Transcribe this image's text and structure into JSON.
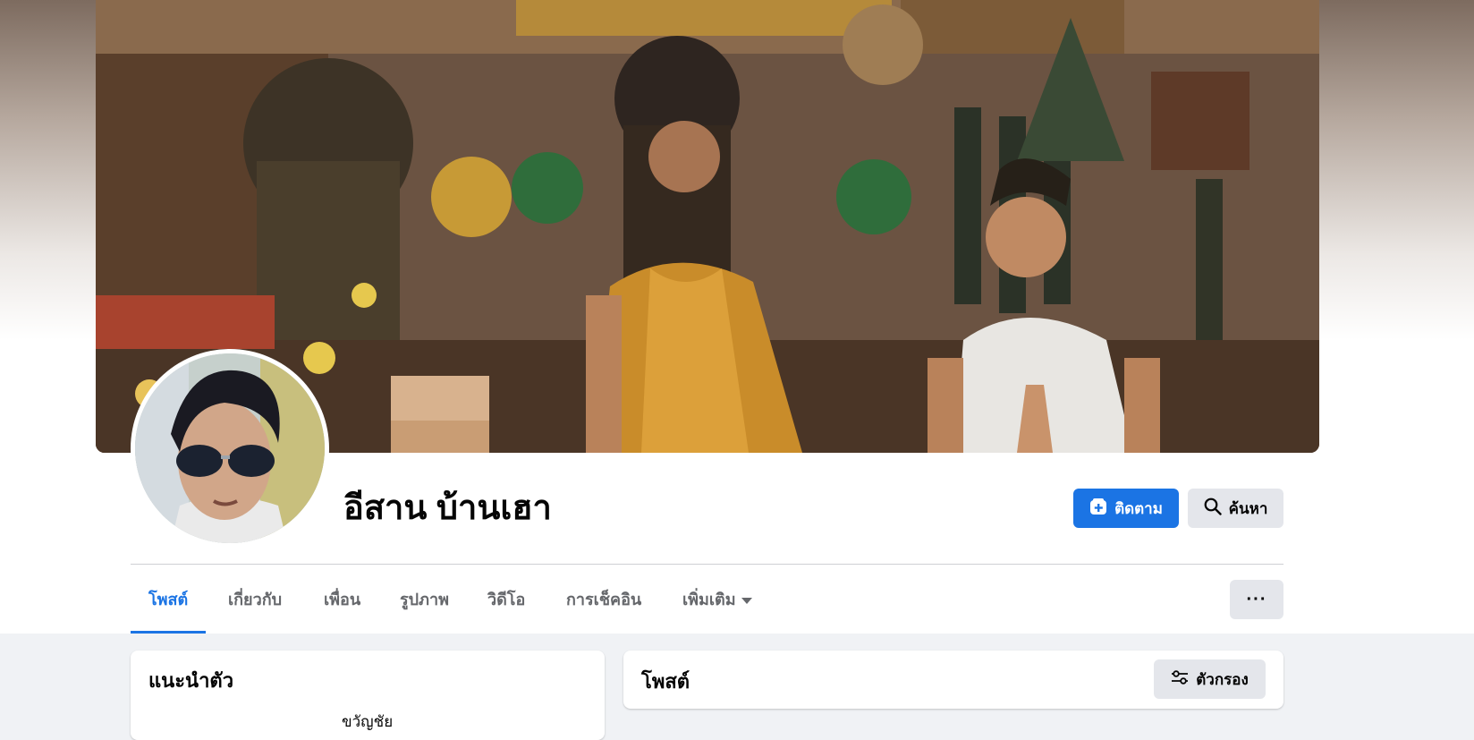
{
  "profile": {
    "name": "อีสาน บ้านเฮา"
  },
  "actions": {
    "follow_label": "ติดตาม",
    "search_label": "ค้นหา",
    "more_options_label": "···"
  },
  "tabs": [
    {
      "label": "โพสต์",
      "active": true
    },
    {
      "label": "เกี่ยวกับ",
      "active": false
    },
    {
      "label": "เพื่อน",
      "active": false
    },
    {
      "label": "รูปภาพ",
      "active": false
    },
    {
      "label": "วิดีโอ",
      "active": false
    },
    {
      "label": "การเช็คอิน",
      "active": false
    },
    {
      "label": "เพิ่มเติม",
      "active": false
    }
  ],
  "intro": {
    "title": "แนะนำตัว",
    "line": "ขวัญชัย"
  },
  "posts": {
    "title": "โพสต์",
    "filter_label": "ตัวกรอง"
  },
  "colors": {
    "accent": "#1b74e4",
    "button_gray": "#e4e6eb",
    "page_bg": "#f0f2f5"
  },
  "icons": {
    "follow": "follow-plus-icon",
    "search": "magnifier-icon",
    "filter": "sliders-icon",
    "more": "caret-down-icon"
  }
}
